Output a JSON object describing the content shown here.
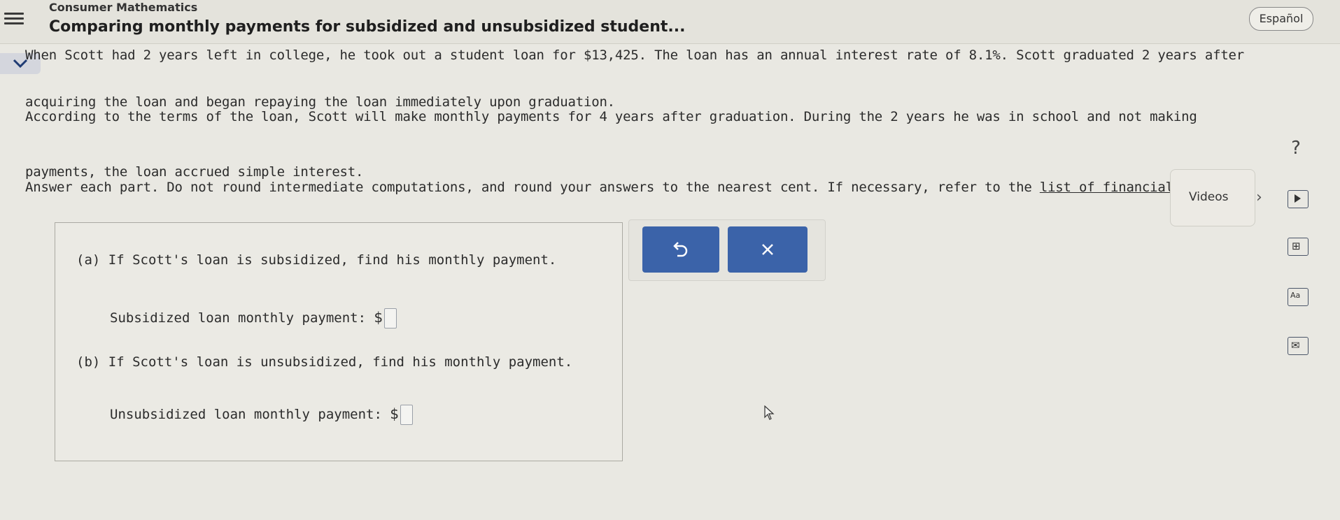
{
  "header": {
    "course": "Consumer Mathematics",
    "topic": "Comparing monthly payments for subsidized and unsubsidized student...",
    "language_button": "Español"
  },
  "problem": {
    "line1": "When Scott had 2 years left in college, he took out a student loan for $13,425. The loan has an annual interest rate of 8.1%. Scott graduated 2 years after",
    "line2": "acquiring the loan and began repaying the loan immediately upon graduation.",
    "line3": "According to the terms of the loan, Scott will make monthly payments for 4 years after graduation. During the 2 years he was in school and not making",
    "line4": "payments, the loan accrued simple interest.",
    "line5_pre": "Answer each part. Do not round intermediate computations, and round your answers to the nearest cent. If necessary, refer to the ",
    "line5_link": "list of financial formulas",
    "line5_post": "."
  },
  "part_a": {
    "question": "(a) If Scott's loan is subsidized, find his monthly payment.",
    "label": "Subsidized loan monthly payment:",
    "currency": "$",
    "value": ""
  },
  "part_b": {
    "question": "(b) If Scott's loan is unsubsidized, find his monthly payment.",
    "label": "Unsubsidized loan monthly payment:",
    "currency": "$",
    "value": ""
  },
  "sidebar": {
    "help": "?",
    "videos": "Videos"
  },
  "icons": {
    "menu": "menu-icon",
    "collapse": "chevron-down-icon",
    "undo": "undo-icon",
    "clear": "close-icon",
    "video": "play-icon",
    "calculator": "calculator-icon",
    "text": "text-size-icon",
    "message": "mail-icon"
  },
  "colors": {
    "accent": "#3b63a9",
    "background": "#e9e8e2"
  }
}
